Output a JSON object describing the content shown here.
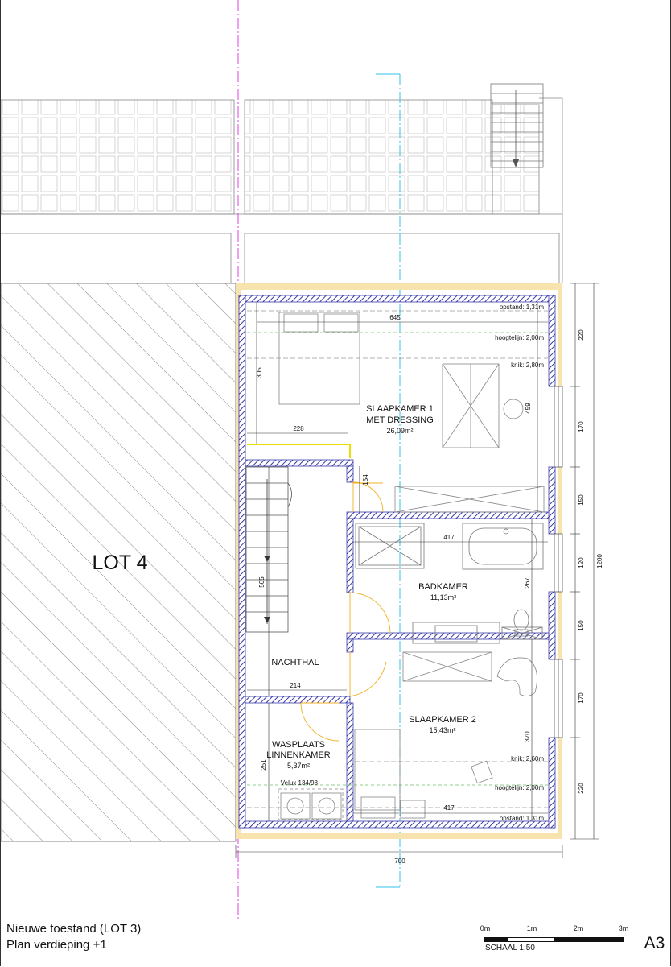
{
  "plan": {
    "lot_label": "LOT 4",
    "rooms": [
      {
        "name": "SLAAPKAMER 1",
        "name2": "MET DRESSING",
        "area": "26,09m²"
      },
      {
        "name": "BADKAMER",
        "area": "11,13m²"
      },
      {
        "name": "NACHTHAL"
      },
      {
        "name": "SLAAPKAMER 2",
        "area": "15,43m²"
      },
      {
        "name": "WASPLAATS",
        "name2": "LINNENKAMER",
        "area": "5,37m²"
      }
    ],
    "annotations": {
      "opstand_top": "opstand: 1,31m",
      "hoogtelijn_top": "hoogtelijn: 2,00m",
      "knik_top": "knik: 2,80m",
      "knik_bottom": "knik: 2,60m",
      "hoogtelijn_bottom": "hoogtelijn: 2,00m",
      "opstand_bottom": "opstand: 1,31m",
      "velux": "Velux 134/98"
    },
    "dimensions": {
      "d645": "645",
      "d305": "305",
      "d228": "228",
      "d459": "459",
      "d154": "154",
      "d417_top": "417",
      "d505": "505",
      "d267": "267",
      "d214": "214",
      "d370": "370",
      "d251": "251",
      "d417_bottom": "417",
      "d700": "700",
      "right_220a": "220",
      "right_170a": "170",
      "right_150a": "150",
      "right_120": "120",
      "right_150b": "150",
      "right_170b": "170",
      "right_220b": "220",
      "right_total": "1200"
    }
  },
  "title_block": {
    "line1": "Nieuwe toestand (LOT 3)",
    "line2": "Plan verdieping +1",
    "scale_ticks": [
      "0m",
      "1m",
      "2m",
      "3m"
    ],
    "scale_label": "SCHAAL 1:50",
    "sheet": "A3"
  },
  "colors": {
    "wall": "#3a3aa8",
    "insulation": "#f6e3ae",
    "axis_magenta": "#e040e0",
    "axis_cyan": "#30c0e8",
    "guide_green": "#8fd08f",
    "door_arc": "#f0b020",
    "yellow_beam": "#e8e000"
  }
}
